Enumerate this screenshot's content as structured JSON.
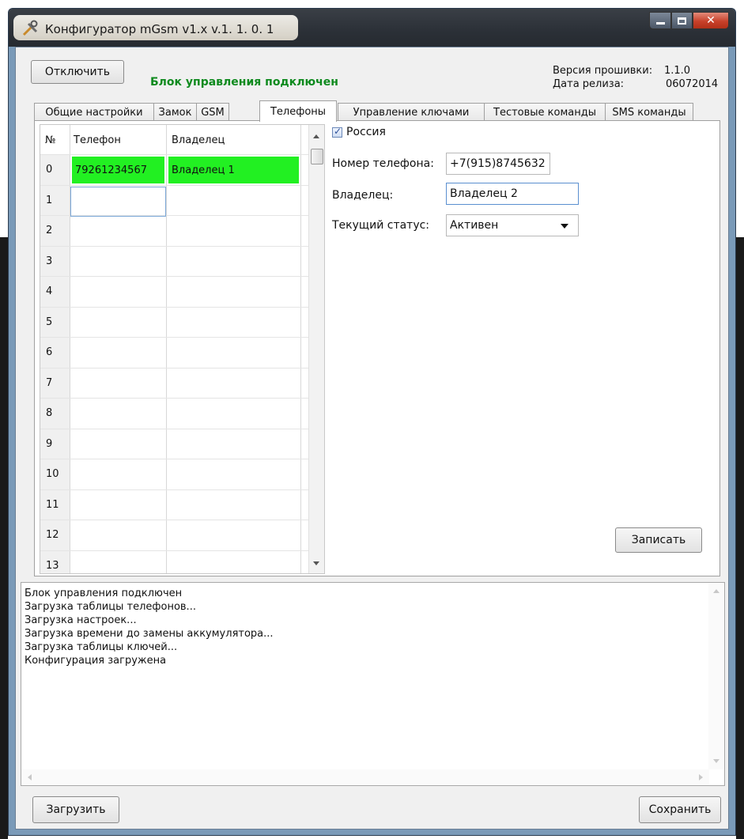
{
  "window": {
    "title": "Конфигуратор mGsm v1.x v.1. 1. 0. 1"
  },
  "header": {
    "disconnect_label": "Отключить",
    "status_text": "Блок управления подключен",
    "firmware_label": "Версия прошивки:",
    "firmware_value": "1.1.0",
    "release_label": "Дата релиза:",
    "release_value": "06072014"
  },
  "tabs": [
    {
      "label": "Общие настройки",
      "active": false
    },
    {
      "label": "Замок",
      "active": false
    },
    {
      "label": "GSM",
      "active": false
    },
    {
      "label": "Телефоны",
      "active": true
    },
    {
      "label": "Управление ключами",
      "active": false
    },
    {
      "label": "Тестовые команды",
      "active": false
    },
    {
      "label": "SMS команды",
      "active": false
    }
  ],
  "phones_table": {
    "columns": [
      "№",
      "Телефон",
      "Владелец"
    ],
    "rows": [
      {
        "num": "0",
        "phone": "79261234567",
        "owner": "Владелец 1"
      },
      {
        "num": "1",
        "phone": "",
        "owner": ""
      },
      {
        "num": "2",
        "phone": "",
        "owner": ""
      },
      {
        "num": "3",
        "phone": "",
        "owner": ""
      },
      {
        "num": "4",
        "phone": "",
        "owner": ""
      },
      {
        "num": "5",
        "phone": "",
        "owner": ""
      },
      {
        "num": "6",
        "phone": "",
        "owner": ""
      },
      {
        "num": "7",
        "phone": "",
        "owner": ""
      },
      {
        "num": "8",
        "phone": "",
        "owner": ""
      },
      {
        "num": "9",
        "phone": "",
        "owner": ""
      },
      {
        "num": "10",
        "phone": "",
        "owner": ""
      },
      {
        "num": "11",
        "phone": "",
        "owner": ""
      },
      {
        "num": "12",
        "phone": "",
        "owner": ""
      },
      {
        "num": "13",
        "phone": "",
        "owner": ""
      }
    ]
  },
  "form": {
    "russia_label": "Россия",
    "russia_checked": true,
    "phone_label": "Номер телефона:",
    "phone_value": "+7(915)8745632",
    "owner_label": "Владелец:",
    "owner_value": "Владелец 2",
    "status_label": "Текущий статус:",
    "status_value": "Активен",
    "write_label": "Записать"
  },
  "log": {
    "lines": [
      "Блок управления подключен",
      "Загрузка таблицы телефонов...",
      "Загрузка настроек...",
      "Загрузка времени до замены аккумулятора...",
      "Загрузка таблицы ключей...",
      "Конфигурация загружена"
    ]
  },
  "footer": {
    "load_label": "Загрузить",
    "save_label": "Сохранить"
  },
  "colors": {
    "status_green": "#0e8a1e",
    "row_highlight": "#22f022"
  }
}
